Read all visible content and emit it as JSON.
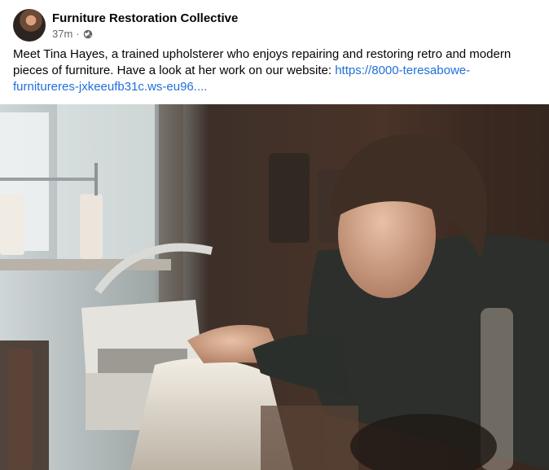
{
  "post": {
    "page_name": "Furniture Restoration Collective",
    "time": "37m",
    "separator": "·",
    "audience_icon": "globe-icon",
    "caption_text": "Meet Tina Hayes, a trained upholsterer who enjoys repairing and restoring retro and modern pieces of furniture.  Have a look at her work on our website: ",
    "caption_link": "https://8000-teresabowe-furnitureres-jxkeeufb31c.ws-eu96...."
  },
  "colors": {
    "link": "#216fdb",
    "secondary_text": "#65676b"
  }
}
